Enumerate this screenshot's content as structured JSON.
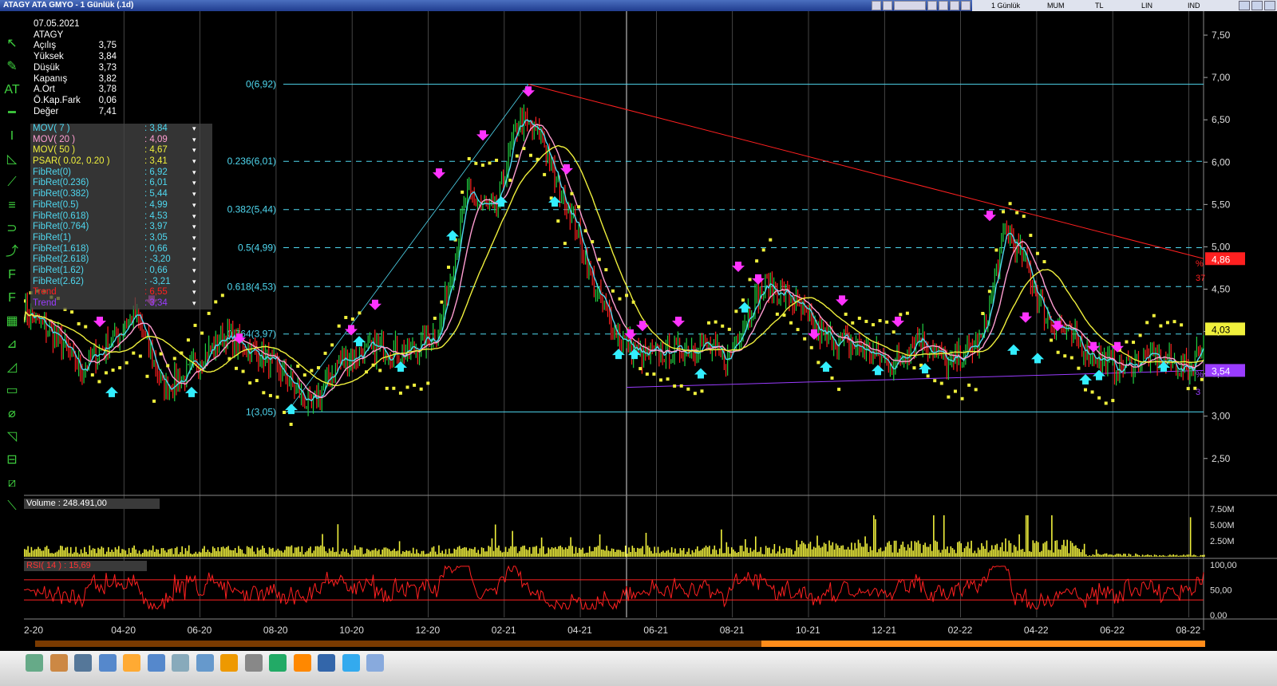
{
  "window": {
    "title": "ATAGY ATA GMYO - 1 Günlük (.1d)",
    "menu": [
      "1 Günlük",
      "MUM",
      "TL",
      "LIN",
      "IND"
    ]
  },
  "info": {
    "date": "07.05.2021",
    "symbol": "ATAGY",
    "rows": [
      {
        "label": "Açılış",
        "value": "3,75"
      },
      {
        "label": "Yüksek",
        "value": "3,84"
      },
      {
        "label": "Düşük",
        "value": "3,73"
      },
      {
        "label": "Kapanış",
        "value": "3,82"
      },
      {
        "label": "A.Ort",
        "value": "3,78"
      },
      {
        "label": "Ö.Kap.Fark",
        "value": "0,06"
      },
      {
        "label": "Değer",
        "value": "7,41"
      }
    ]
  },
  "legend": [
    {
      "name": "MOV( 7 )",
      "value": ": 3,84",
      "color": "#4fd8f0"
    },
    {
      "name": "MOV( 20 )",
      "value": ": 4,09",
      "color": "#ff9ed2"
    },
    {
      "name": "MOV( 50 )",
      "value": ": 4,67",
      "color": "#f0f03c"
    },
    {
      "name": "PSAR( 0.02, 0.20 )",
      "value": ": 3,41",
      "color": "#f0f03c"
    },
    {
      "name": "FibRet(0)",
      "value": ": 6,92",
      "color": "#4fd8f0"
    },
    {
      "name": "FibRet(0.236)",
      "value": ": 6,01",
      "color": "#4fd8f0"
    },
    {
      "name": "FibRet(0.382)",
      "value": ": 5,44",
      "color": "#4fd8f0"
    },
    {
      "name": "FibRet(0.5)",
      "value": ": 4,99",
      "color": "#4fd8f0"
    },
    {
      "name": "FibRet(0.618)",
      "value": ": 4,53",
      "color": "#4fd8f0"
    },
    {
      "name": "FibRet(0.764)",
      "value": ": 3,97",
      "color": "#4fd8f0"
    },
    {
      "name": "FibRet(1)",
      "value": ": 3,05",
      "color": "#4fd8f0"
    },
    {
      "name": "FibRet(1.618)",
      "value": ": 0,66",
      "color": "#4fd8f0"
    },
    {
      "name": "FibRet(2.618)",
      "value": ": -3,20",
      "color": "#4fd8f0"
    },
    {
      "name": "FibRet(1.62)",
      "value": ": 0,66",
      "color": "#4fd8f0"
    },
    {
      "name": "FibRet(2.62)",
      "value": ": -3,21",
      "color": "#4fd8f0"
    },
    {
      "name": "Trend",
      "value": ": 6,55",
      "color": "#ff2020"
    },
    {
      "name": "Trend",
      "value": ": 3,34",
      "color": "#9a3cff"
    }
  ],
  "colors": {
    "price_up": "#20d040",
    "price_down": "#ff2020",
    "ma7": "#4fd8f0",
    "ma20": "#ff9ed2",
    "ma50": "#f0f03c",
    "psar": "#f0f03c",
    "fib": "#4fd8f0",
    "trend_down": "#ff2020",
    "trend_up": "#9a3cff",
    "volume": "#f0f03c",
    "rsi": "#ff2020"
  },
  "fib_levels": [
    {
      "label": "0(6,92)",
      "value": 6.92
    },
    {
      "label": "0.236(6,01)",
      "value": 6.01
    },
    {
      "label": "0.382(5,44)",
      "value": 5.44
    },
    {
      "label": "0.5(4,99)",
      "value": 4.99
    },
    {
      "label": "0.618(4,53)",
      "value": 4.53
    },
    {
      "label": "0.764(3,97)",
      "value": 3.97
    },
    {
      "label": "1(3,05)",
      "value": 3.05
    }
  ],
  "price_axis": [
    "7,50",
    "7,00",
    "6,50",
    "6,00",
    "5,50",
    "5,00",
    "4,50",
    "4,00",
    "3,50",
    "3,00",
    "2,50"
  ],
  "price_markers": [
    {
      "value": 4.86,
      "label": "4,86",
      "bg": "#ff2020",
      "fg": "#fff"
    },
    {
      "value": 4.03,
      "label": "4,03",
      "bg": "#f0f03c",
      "fg": "#000"
    },
    {
      "value": 3.54,
      "label": "3,54",
      "bg": "#9a3cff",
      "fg": "#fff"
    }
  ],
  "trend_tags": {
    "top_pct": "%",
    "top_num": "37",
    "bottom_pct": "%",
    "bottom_num": "3"
  },
  "x_labels": [
    "2-20",
    "04-20",
    "06-20",
    "08-20",
    "10-20",
    "12-20",
    "02-21",
    "04-21",
    "06-21",
    "08-21",
    "10-21",
    "12-21",
    "02-22",
    "04-22",
    "06-22",
    "08-22"
  ],
  "volume": {
    "label": "Volume : 248.491,00",
    "axis": [
      "7.50M",
      "5.00M",
      "2.50M"
    ]
  },
  "rsi": {
    "label": "RSI( 14 )",
    "value": ": 15,69",
    "axis": [
      "100,00",
      "50,00",
      "0,00"
    ],
    "levels": [
      70,
      30
    ]
  },
  "chart_data": {
    "type": "line",
    "title": "ATAGY ATA GMYO - 1 Günlük (.1d)",
    "xlabel": "",
    "ylabel": "",
    "ylim": [
      2.2,
      7.7
    ],
    "x": [
      "2-20",
      "04-20",
      "06-20",
      "08-20",
      "10-20",
      "12-20",
      "02-21",
      "04-21",
      "06-21",
      "08-21",
      "10-21",
      "12-21",
      "02-22",
      "04-22",
      "06-22",
      "08-22"
    ],
    "series": [
      {
        "name": "",
        "values": [
          4.2,
          3.55,
          3.6,
          3.75,
          3.25,
          4.1,
          6.1,
          5.6,
          3.7,
          4.3,
          3.8,
          3.7,
          4.5,
          3.9,
          3.6,
          3.9
        ]
      }
    ]
  }
}
